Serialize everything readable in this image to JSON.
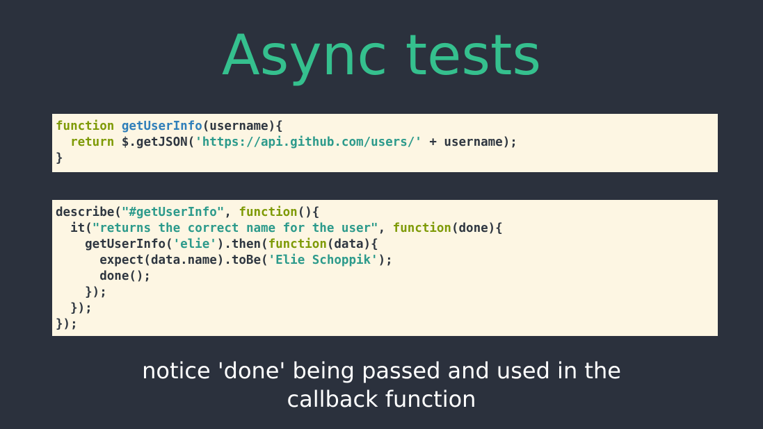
{
  "title": "Async tests",
  "colors": {
    "background": "#2b313d",
    "title": "#35c08e",
    "code_background": "#fdf6e3",
    "keyword": "#7e9a06",
    "function_name": "#2f7fba",
    "string": "#2c9a8b",
    "plain": "#2e3640",
    "caption": "#ffffff"
  },
  "code_block_1": {
    "lines": [
      [
        {
          "type": "keyword",
          "text": "function"
        },
        {
          "type": "plain",
          "text": " "
        },
        {
          "type": "func",
          "text": "getUserInfo"
        },
        {
          "type": "plain",
          "text": "(username){"
        }
      ],
      [
        {
          "type": "plain",
          "text": "  "
        },
        {
          "type": "keyword",
          "text": "return"
        },
        {
          "type": "plain",
          "text": " $.getJSON("
        },
        {
          "type": "string",
          "text": "'https://api.github.com/users/'"
        },
        {
          "type": "plain",
          "text": " + username);"
        }
      ],
      [
        {
          "type": "plain",
          "text": "}"
        }
      ]
    ]
  },
  "code_block_2": {
    "lines": [
      [
        {
          "type": "plain",
          "text": "describe("
        },
        {
          "type": "string",
          "text": "\"#getUserInfo\""
        },
        {
          "type": "plain",
          "text": ", "
        },
        {
          "type": "keyword",
          "text": "function"
        },
        {
          "type": "plain",
          "text": "(){"
        }
      ],
      [
        {
          "type": "plain",
          "text": "  it("
        },
        {
          "type": "string",
          "text": "\"returns the correct name for the user\""
        },
        {
          "type": "plain",
          "text": ", "
        },
        {
          "type": "keyword",
          "text": "function"
        },
        {
          "type": "plain",
          "text": "(done){"
        }
      ],
      [
        {
          "type": "plain",
          "text": "    getUserInfo("
        },
        {
          "type": "string",
          "text": "'elie'"
        },
        {
          "type": "plain",
          "text": ").then("
        },
        {
          "type": "keyword",
          "text": "function"
        },
        {
          "type": "plain",
          "text": "(data){"
        }
      ],
      [
        {
          "type": "plain",
          "text": "      expect(data.name).toBe("
        },
        {
          "type": "string",
          "text": "'Elie Schoppik'"
        },
        {
          "type": "plain",
          "text": ");"
        }
      ],
      [
        {
          "type": "plain",
          "text": "      done();"
        }
      ],
      [
        {
          "type": "plain",
          "text": "    });"
        }
      ],
      [
        {
          "type": "plain",
          "text": "  });"
        }
      ],
      [
        {
          "type": "plain",
          "text": "});"
        }
      ]
    ]
  },
  "caption": {
    "line1": "notice 'done' being passed and used in the",
    "line2": "callback function"
  }
}
